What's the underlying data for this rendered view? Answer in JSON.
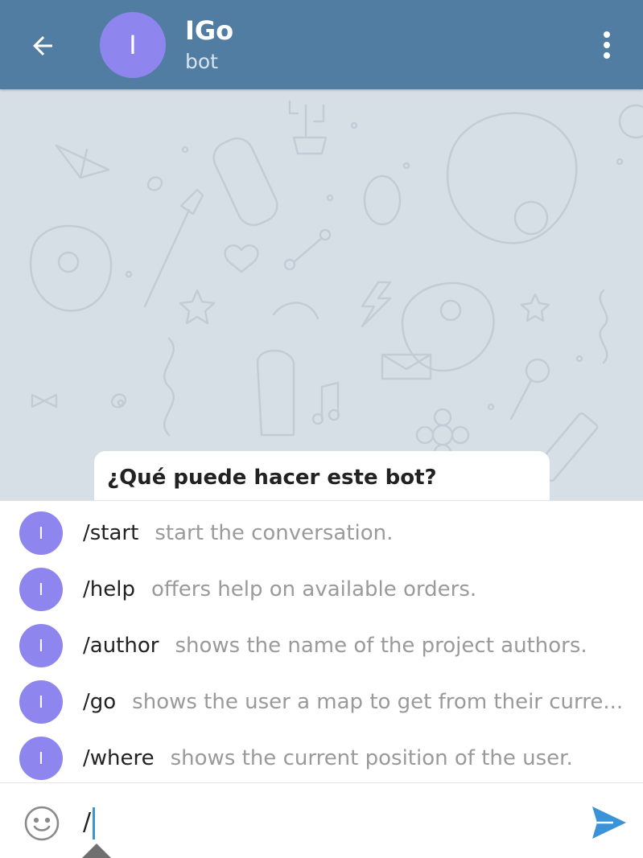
{
  "header": {
    "back_icon": "arrow-left-icon",
    "avatar_letter": "I",
    "avatar_color": "#8e85ee",
    "title": "IGo",
    "subtitle": "bot",
    "menu_icon": "more-vertical-icon",
    "background_color": "#527da3"
  },
  "chat": {
    "background_color": "#d7dfe6",
    "info_card": {
      "title": "¿Qué puede hacer este bot?"
    }
  },
  "commands": [
    {
      "avatar_letter": "I",
      "command": "/start",
      "description": "start the conversation."
    },
    {
      "avatar_letter": "I",
      "command": "/help",
      "description": "offers help on available orders."
    },
    {
      "avatar_letter": "I",
      "command": "/author",
      "description": "shows the name of the project authors."
    },
    {
      "avatar_letter": "I",
      "command": "/go",
      "description": "shows the user a map to get from their curre..."
    },
    {
      "avatar_letter": "I",
      "command": "/where",
      "description": "shows the current position of the user."
    }
  ],
  "input": {
    "emoji_icon": "smiley-icon",
    "value": "/",
    "send_icon": "send-icon",
    "send_color": "#3a93d8"
  }
}
